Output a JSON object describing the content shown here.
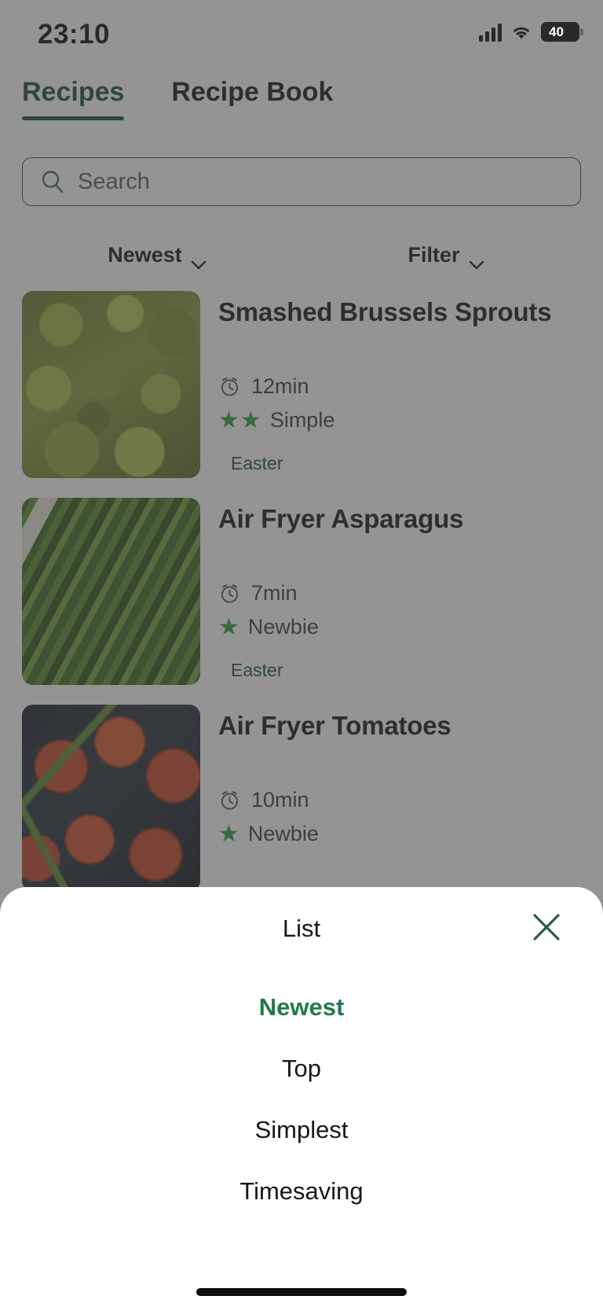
{
  "statusbar": {
    "time": "23:10",
    "battery_level": "40",
    "signal_icon": "cellular-bars-icon",
    "wifi_icon": "wifi-icon",
    "battery_icon": "battery-icon"
  },
  "tabs": [
    {
      "label": "Recipes",
      "active": true
    },
    {
      "label": "Recipe Book",
      "active": false
    }
  ],
  "search": {
    "placeholder": "Search",
    "value": "",
    "icon": "search-icon"
  },
  "filter_bar": [
    {
      "label": "Newest",
      "icon": "chevron-down-icon"
    },
    {
      "label": "Filter",
      "icon": "chevron-down-icon"
    }
  ],
  "recipes": [
    {
      "title": "Smashed Brussels Sprouts",
      "time": "12min",
      "difficulty": "Simple",
      "stars": 2,
      "tags": [
        "Easter"
      ],
      "image": "smashed-brussels-sprouts-photo"
    },
    {
      "title": "Air Fryer Asparagus",
      "time": "7min",
      "difficulty": "Newbie",
      "stars": 1,
      "tags": [
        "Easter"
      ],
      "image": "air-fryer-asparagus-photo"
    },
    {
      "title": "Air Fryer Tomatoes",
      "time": "10min",
      "difficulty": "Newbie",
      "stars": 1,
      "tags": [],
      "image": "air-fryer-tomatoes-photo"
    }
  ],
  "sheet": {
    "title": "List",
    "close_icon": "close-icon",
    "options": [
      {
        "label": "Newest",
        "selected": true
      },
      {
        "label": "Top",
        "selected": false
      },
      {
        "label": "Simplest",
        "selected": false
      },
      {
        "label": "Timesaving",
        "selected": false
      }
    ]
  },
  "colors": {
    "brand_green": "#1f4d38",
    "selected_green": "#1f7a4c",
    "star_green": "#2aa03f",
    "text_dark": "#17171a",
    "scrim": "rgba(64,64,64,.56)"
  }
}
